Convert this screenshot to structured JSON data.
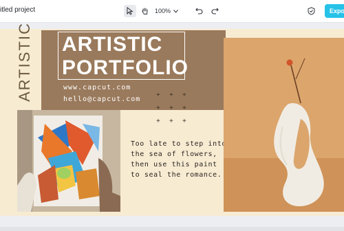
{
  "app": {
    "project_title": "itled project"
  },
  "toolbar": {
    "select_icon": "cursor-arrow-icon",
    "hand_icon": "hand-pan-icon",
    "zoom_value": "100%",
    "undo_icon": "undo-icon",
    "redo_icon": "redo-icon",
    "shield_icon": "shield-icon",
    "export_label": "Expo"
  },
  "design": {
    "side_label": "ARTISTIC",
    "title_line1": "ARTISTIC",
    "title_line2": "PORTFOLIO",
    "website": "www.capcut.com",
    "email": "hello@capcut.com",
    "description": "Too late to step into the sea of flowers, then use this paint to seal the romance."
  },
  "colors": {
    "brown": "#9a7a5c",
    "beige": "#f7ebd2",
    "export_button": "#27c2e8"
  }
}
